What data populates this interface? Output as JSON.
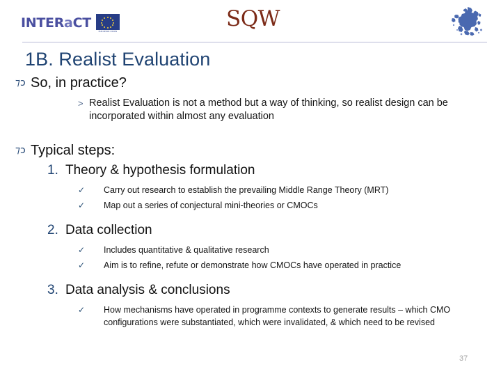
{
  "header": {
    "interact_logo": {
      "word_upper_1": "INTER",
      "word_lower": "a",
      "word_upper_2": "CT",
      "full_text": "INTERACT",
      "eu_caption": "EUROPEAN UNION"
    },
    "center_logo": "SQW",
    "right_logo_name": "europe-map"
  },
  "title": "1B. Realist Evaluation",
  "colors": {
    "title_navy": "#1F4372",
    "sqw_maroon": "#7C2B18",
    "interact_blue": "#4A4FA0",
    "eu_flag_blue": "#273D86",
    "eu_star_yellow": "#F6D33A",
    "rule_lavender": "#B7B9D6",
    "check_blue": "#2C5277",
    "slide_number_grey": "#A6A6A6"
  },
  "bullets": {
    "ornament_glyph": "⁊ɔ",
    "ornament_name": "aldus-leaf-ornament",
    "chevron_glyph": ">",
    "check_glyph": "✓"
  },
  "body": {
    "section_1": {
      "heading": "So, in practice?",
      "points": [
        "Realist Evaluation is not a method but a way of thinking, so realist design can be incorporated within almost any evaluation"
      ]
    },
    "section_2": {
      "heading": "Typical steps:",
      "steps": [
        {
          "number": "1.",
          "label": "Theory & hypothesis formulation",
          "checks": [
            "Carry out research to establish the prevailing Middle Range Theory (MRT)",
            "Map out a series of conjectural mini-theories or CMOCs"
          ]
        },
        {
          "number": "2.",
          "label": "Data collection",
          "checks": [
            "Includes quantitative & qualitative research",
            "Aim is to refine, refute or demonstrate how CMOCs have operated in practice"
          ]
        },
        {
          "number": "3.",
          "label": "Data analysis & conclusions",
          "checks": [
            "How mechanisms have operated in programme contexts to generate results – which CMO configurations were substantiated, which were invalidated, & which need to be revised"
          ]
        }
      ]
    }
  },
  "slide_number": "37"
}
